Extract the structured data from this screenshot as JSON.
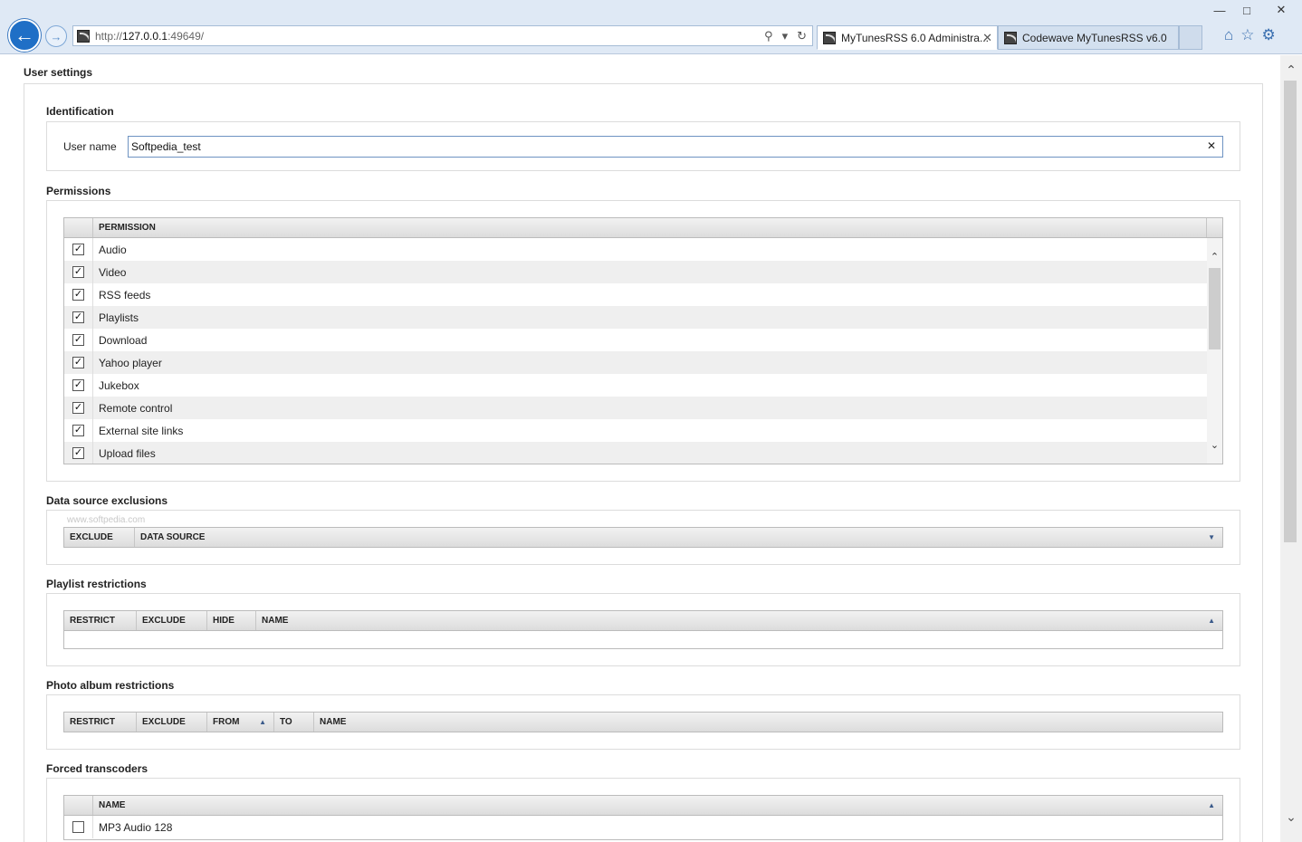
{
  "browser": {
    "url_prefix": "http://",
    "url_host": "127.0.0.1",
    "url_rest": ":49649/",
    "tabs": [
      {
        "title": "MyTunesRSS 6.0 Administra...",
        "active": true
      },
      {
        "title": "Codewave MyTunesRSS v6.0",
        "active": false
      }
    ]
  },
  "page": {
    "title": "User settings",
    "identification": {
      "title": "Identification",
      "username_label": "User name",
      "username_value": "Softpedia_test"
    },
    "permissions": {
      "title": "Permissions",
      "column": "PERMISSION",
      "items": [
        {
          "label": "Audio",
          "checked": true
        },
        {
          "label": "Video",
          "checked": true
        },
        {
          "label": "RSS feeds",
          "checked": true
        },
        {
          "label": "Playlists",
          "checked": true
        },
        {
          "label": "Download",
          "checked": true
        },
        {
          "label": "Yahoo player",
          "checked": true
        },
        {
          "label": "Jukebox",
          "checked": true
        },
        {
          "label": "Remote control",
          "checked": true
        },
        {
          "label": "External site links",
          "checked": true
        },
        {
          "label": "Upload files",
          "checked": true
        }
      ]
    },
    "data_source_exclusions": {
      "title": "Data source exclusions",
      "columns": [
        "EXCLUDE",
        "DATA SOURCE"
      ],
      "watermark": "www.softpedia.com"
    },
    "playlist_restrictions": {
      "title": "Playlist restrictions",
      "columns": [
        "RESTRICT",
        "EXCLUDE",
        "HIDE",
        "NAME"
      ]
    },
    "photo_album_restrictions": {
      "title": "Photo album restrictions",
      "columns": [
        "RESTRICT",
        "EXCLUDE",
        "FROM",
        "TO",
        "NAME"
      ]
    },
    "forced_transcoders": {
      "title": "Forced transcoders",
      "column": "NAME",
      "items": [
        {
          "label": "MP3 Audio 128",
          "checked": false
        }
      ]
    }
  },
  "colors": {
    "chrome_bg": "#dfe9f5",
    "back_button": "#1f6fc6",
    "input_border": "#6e93c2"
  }
}
